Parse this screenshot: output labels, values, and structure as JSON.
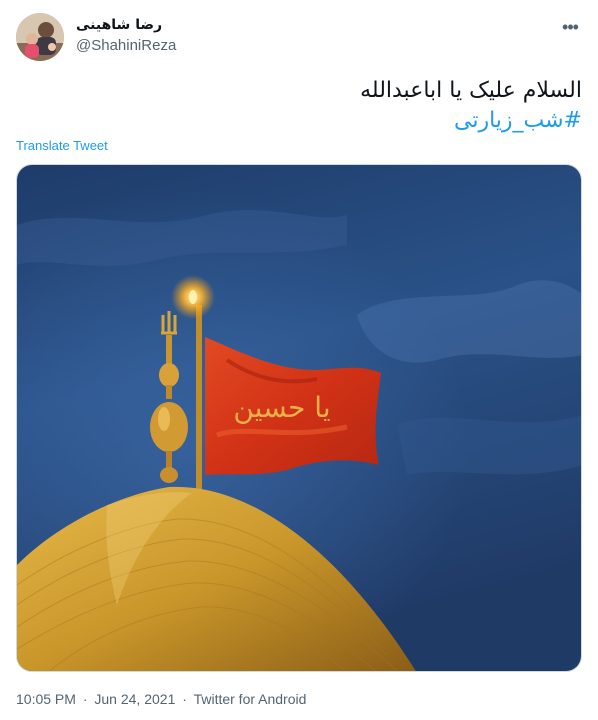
{
  "tweet": {
    "author": {
      "display_name": "رضا شاهینی",
      "handle": "@ShahiniReza"
    },
    "more_icon": "more-horizontal-icon",
    "text_line": "السلام علیک یا اباعبدالله",
    "hashtag": "#شب_زیارتی",
    "translate_label": "Translate Tweet",
    "image": {
      "flag_text": "یا حسین",
      "dome_color": "#c99a2a",
      "flag_color": "#d8341a",
      "sky_color": "#24477a"
    },
    "meta": {
      "time": "10:05 PM",
      "date": "Jun 24, 2021",
      "separator": "·",
      "source": "Twitter for Android"
    }
  }
}
